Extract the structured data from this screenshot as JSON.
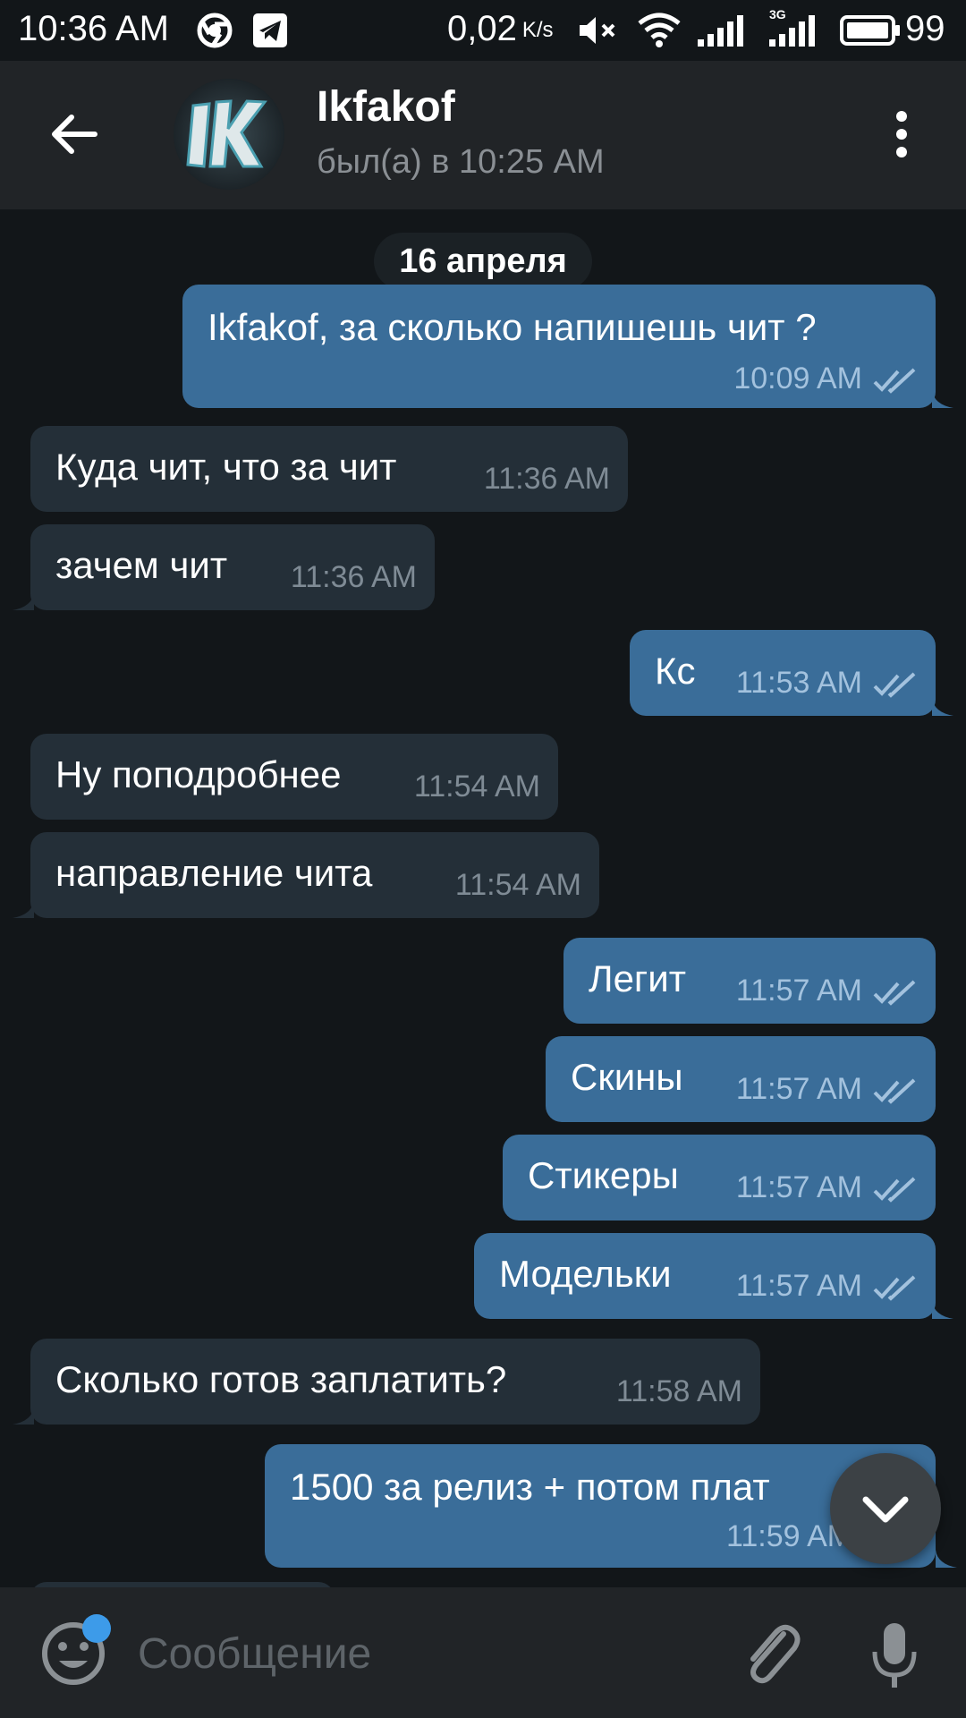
{
  "status_bar": {
    "time": "10:36 AM",
    "net_speed": "0,02",
    "net_speed_unit": "K/s",
    "network_type": "3G",
    "battery": "99",
    "icons": [
      "chrome-icon",
      "telegram-icon",
      "mute-icon",
      "wifi-icon",
      "signal-icon",
      "signal-3g-icon",
      "battery-icon"
    ]
  },
  "header": {
    "back_icon": "arrow-left-icon",
    "avatar_text": "1K",
    "contact_name": "Ikfakof",
    "last_seen": "был(а) в 10:25 AM",
    "menu_icon": "more-vert-icon"
  },
  "chat": {
    "date_label": "16 апреля",
    "messages": [
      {
        "dir": "out",
        "text": "Ikfakof, за сколько напишешь чит ?",
        "time": "10:09 AM",
        "read": true
      },
      {
        "dir": "in",
        "text": "Куда чит, что за чит",
        "time": "11:36 AM"
      },
      {
        "dir": "in",
        "text": "зачем чит",
        "time": "11:36 AM"
      },
      {
        "dir": "out",
        "text": "Кс",
        "time": "11:53 AM",
        "read": true
      },
      {
        "dir": "in",
        "text": "Ну поподробнее",
        "time": "11:54 AM"
      },
      {
        "dir": "in",
        "text": "направление чита",
        "time": "11:54 AM"
      },
      {
        "dir": "out",
        "text": "Легит",
        "time": "11:57 AM",
        "read": true
      },
      {
        "dir": "out",
        "text": "Скины",
        "time": "11:57 AM",
        "read": true
      },
      {
        "dir": "out",
        "text": "Стикеры",
        "time": "11:57 AM",
        "read": true
      },
      {
        "dir": "out",
        "text": "Модельки",
        "time": "11:57 AM",
        "read": true
      },
      {
        "dir": "in",
        "text": "Сколько готов заплатить?",
        "time": "11:58 AM"
      },
      {
        "dir": "out",
        "text": "1500 за релиз + потом плат",
        "time": "11:59 AM",
        "read": true
      }
    ],
    "scroll_down_icon": "chevron-down-icon"
  },
  "input_bar": {
    "emoji_icon": "smile-icon",
    "placeholder": "Сообщение",
    "value": "",
    "attach_icon": "paperclip-icon",
    "mic_icon": "microphone-icon"
  },
  "colors": {
    "background": "#121619",
    "header": "#212427",
    "outgoing_bubble": "#3a6d99",
    "incoming_bubble": "#242f38",
    "accent": "#3d9be9"
  }
}
